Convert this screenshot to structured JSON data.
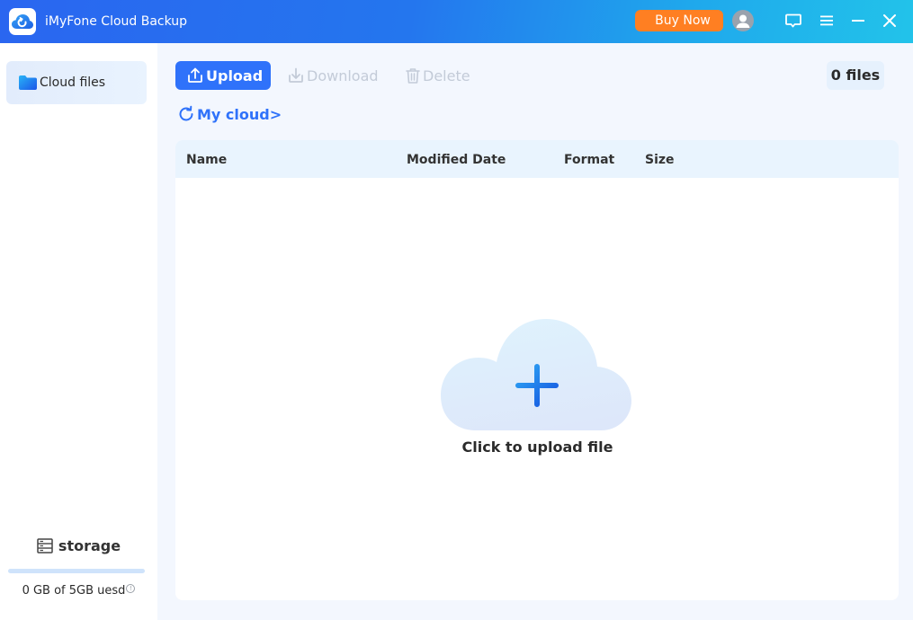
{
  "titlebar": {
    "app_title": "iMyFone Cloud Backup",
    "buy_now_label": "Buy Now",
    "icons": [
      "app-logo-icon",
      "user-avatar-icon",
      "feedback-icon",
      "menu-icon",
      "minimize-icon",
      "close-icon"
    ],
    "accent_color": "#ff7f22"
  },
  "sidebar": {
    "items": [
      {
        "label": "Cloud files",
        "icon": "folder-icon",
        "active": true
      }
    ],
    "storage": {
      "title": "storage",
      "used_fraction": 0,
      "usage_text": "0 GB of 5GB uesd",
      "info_glyph": "!"
    }
  },
  "toolbar": {
    "upload_label": "Upload",
    "download_label": "Download",
    "delete_label": "Delete",
    "files_count": "0 files"
  },
  "breadcrumb": {
    "label": "My cloud>"
  },
  "table": {
    "columns": [
      "Name",
      "Modified Date",
      "Format",
      "Size"
    ],
    "rows": []
  },
  "empty_state": {
    "label": "Click to upload file"
  },
  "colors": {
    "primary": "#2f72fa",
    "disabled": "#c3cbd8",
    "header_bg": "#e9f4fe"
  }
}
